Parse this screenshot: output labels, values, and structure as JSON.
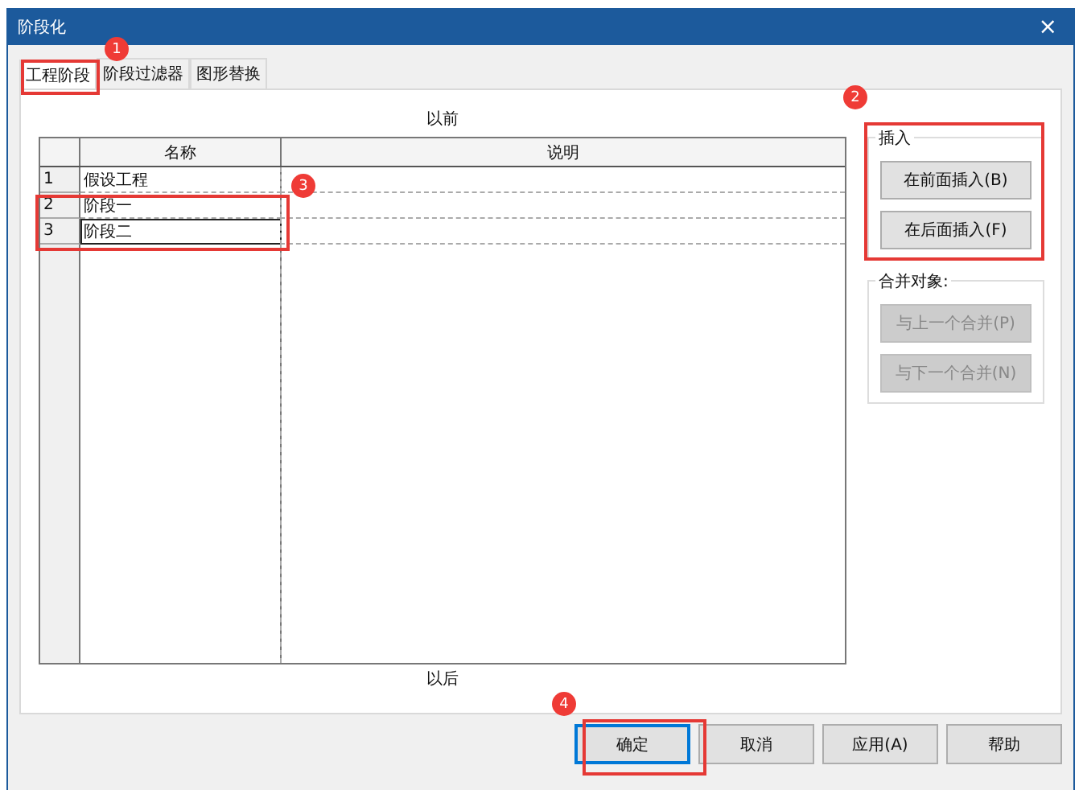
{
  "window": {
    "title": "阶段化",
    "close": "×"
  },
  "tabs": [
    {
      "label": "工程阶段",
      "selected": true
    },
    {
      "label": "阶段过滤器",
      "selected": false
    },
    {
      "label": "图形替换",
      "selected": false
    }
  ],
  "table": {
    "caption_top": "以前",
    "caption_bottom": "以后",
    "columns": [
      "名称",
      "说明"
    ],
    "rows": [
      {
        "number": "1",
        "name": "假设工程",
        "selected": false
      },
      {
        "number": "2",
        "name": "阶段一",
        "selected": false
      },
      {
        "number": "3",
        "name": "阶段二",
        "selected": true
      }
    ]
  },
  "insert_group": {
    "title": "插入",
    "buttons": [
      {
        "label": "在前面插入(B)",
        "disabled": false
      },
      {
        "label": "在后面插入(F)",
        "disabled": false
      }
    ]
  },
  "merge_group": {
    "title": "合并对象:",
    "buttons": [
      {
        "label": "与上一个合并(P)",
        "disabled": true
      },
      {
        "label": "与下一个合并(N)",
        "disabled": true
      }
    ]
  },
  "footer_buttons": [
    {
      "label": "确定",
      "focused": true
    },
    {
      "label": "取消",
      "focused": false
    },
    {
      "label": "应用(A)",
      "focused": false
    },
    {
      "label": "帮助",
      "focused": false
    }
  ],
  "annotations": [
    {
      "number": "1",
      "kind": "tab"
    },
    {
      "number": "2",
      "kind": "insert"
    },
    {
      "number": "3",
      "kind": "rows"
    },
    {
      "number": "4",
      "kind": "ok"
    }
  ]
}
